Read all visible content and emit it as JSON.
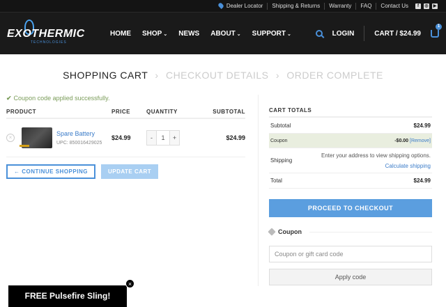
{
  "topbar": {
    "dealer": "Dealer Locator",
    "shipping": "Shipping & Returns",
    "warranty": "Warranty",
    "faq": "FAQ",
    "contact": "Contact Us"
  },
  "header": {
    "logo_word": "EXOTHERMIC",
    "logo_sub": "TECHNOLOGIES",
    "nav": {
      "home": "HOME",
      "shop": "SHOP",
      "news": "NEWS",
      "about": "ABOUT",
      "support": "SUPPORT"
    },
    "login": "LOGIN",
    "cart": "CART / $24.99",
    "cart_count": "1"
  },
  "steps": {
    "cart": "SHOPPING CART",
    "checkout": "CHECKOUT DETAILS",
    "complete": "ORDER COMPLETE"
  },
  "notice": "Coupon code applied successfully.",
  "table": {
    "headers": {
      "product": "PRODUCT",
      "price": "PRICE",
      "quantity": "QUANTITY",
      "subtotal": "SUBTOTAL"
    },
    "item": {
      "name": "Spare Battery",
      "upc": "UPC: 850016429025",
      "price": "$24.99",
      "qty": "1",
      "subtotal": "$24.99"
    }
  },
  "buttons": {
    "continue": "← CONTINUE SHOPPING",
    "update": "UPDATE CART"
  },
  "totals": {
    "title": "CART TOTALS",
    "subtotal_label": "Subtotal",
    "subtotal_value": "$24.99",
    "coupon_label": "Coupon",
    "coupon_value": "-$0.00",
    "coupon_remove": "[Remove]",
    "shipping_label": "Shipping",
    "shipping_text": "Enter your address to view shipping options.",
    "shipping_calc": "Calculate shipping",
    "total_label": "Total",
    "total_value": "$24.99",
    "checkout": "PROCEED TO CHECKOUT"
  },
  "coupon": {
    "title": "Coupon",
    "placeholder": "Coupon or gift card code",
    "apply": "Apply code"
  },
  "promo": {
    "text": "FREE Pulsefire Sling!"
  }
}
